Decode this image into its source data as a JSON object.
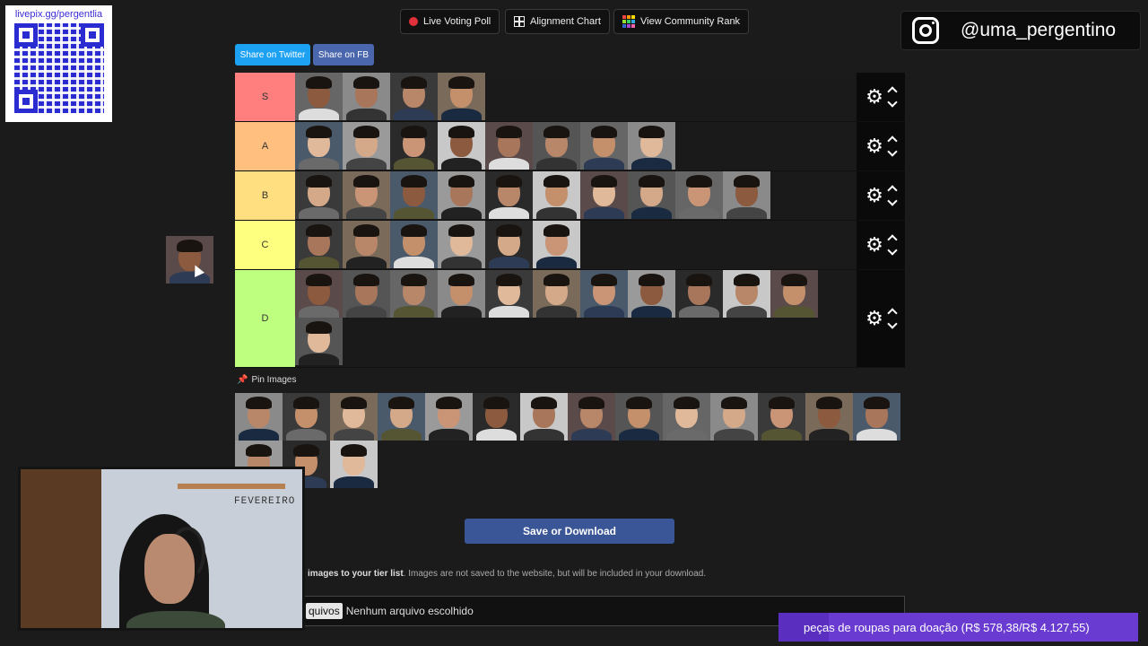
{
  "qr": {
    "url": "livepix.gg/pergentlia"
  },
  "top_buttons": {
    "live_voting": "Live Voting Poll",
    "alignment_chart": "Alignment Chart",
    "community_rank": "View Community Rank"
  },
  "instagram": {
    "handle": "@uma_pergentino",
    "icon": "instagram-icon"
  },
  "share": {
    "twitter": "Share on Twitter",
    "facebook": "Share on FB"
  },
  "colors": {
    "tier_S": "#ff7f7f",
    "tier_A": "#ffbf7f",
    "tier_B": "#ffdf7f",
    "tier_C": "#ffff7f",
    "tier_D": "#bfff7f",
    "twitter": "#1da1f2",
    "facebook": "#4a66ad",
    "save": "#3a5696",
    "donation_bar": "#6a3bd0"
  },
  "tiers": [
    {
      "label": "S",
      "count": 4
    },
    {
      "label": "A",
      "count": 8
    },
    {
      "label": "B",
      "count": 10
    },
    {
      "label": "C",
      "count": 6
    },
    {
      "label": "D",
      "count": 12
    }
  ],
  "pin_images": {
    "label": "Pin Images",
    "count": 17
  },
  "save_button": "Save or Download",
  "hint": {
    "bold": "images to your tier list",
    "rest": ". Images are not saved to the website, but will be included in your download."
  },
  "file_input": {
    "button": "quivos",
    "status": "Nenhum arquivo escolhido"
  },
  "donation": {
    "text": "peças de roupas para doação (R$ 578,38/R$ 4.127,55)",
    "progress": 0.14
  },
  "webcam": {
    "calendar_text": "FEVEREIRO"
  }
}
